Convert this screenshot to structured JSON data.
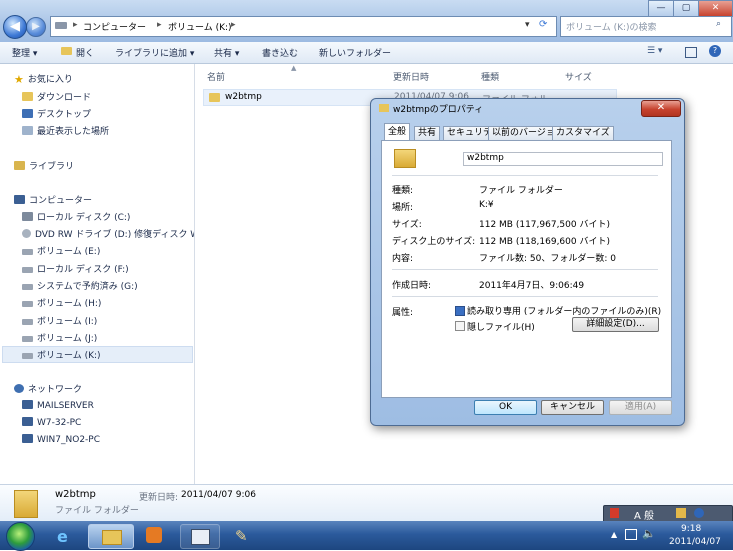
{
  "explorer": {
    "address_parts": [
      "コンピューター",
      "ボリューム (K:)"
    ],
    "search_placeholder": "ボリューム (K:)の検索",
    "commands": [
      "整理 ▾",
      "開く",
      "ライブラリに追加 ▾",
      "共有 ▾",
      "書き込む",
      "新しいフォルダー"
    ],
    "nav": {
      "favorites": "お気に入り",
      "favorites_items": [
        "ダウンロード",
        "デスクトップ",
        "最近表示した場所"
      ],
      "libraries": "ライブラリ",
      "computer": "コンピューター",
      "drives": [
        "ローカル ディスク (C:)",
        "DVD RW ドライブ (D:) 修復ディスク W",
        "ボリューム (E:)",
        "ローカル ディスク (F:)",
        "システムで予約済み (G:)",
        "ボリューム (H:)",
        "ボリューム (I:)",
        "ボリューム (J:)",
        "ボリューム (K:)"
      ],
      "network": "ネットワーク",
      "network_items": [
        "MAILSERVER",
        "W7-32-PC",
        "WIN7_NO2-PC"
      ]
    },
    "columns": [
      "名前",
      "更新日時",
      "種類",
      "サイズ"
    ],
    "file": {
      "name": "w2btmp",
      "modified": "2011/04/07 9:06",
      "type": "ファイル フォル"
    },
    "details": {
      "name": "w2btmp",
      "type": "ファイル フォルダー",
      "modified_label": "更新日時:",
      "modified": "2011/04/07 9:06"
    }
  },
  "dialog": {
    "title": "w2btmpのプロパティ",
    "tabs": [
      "全般",
      "共有",
      "セキュリティ",
      "以前のバージョン",
      "カスタマイズ"
    ],
    "name_value": "w2btmp",
    "fields": [
      {
        "label": "種類:",
        "value": "ファイル フォルダー"
      },
      {
        "label": "場所:",
        "value": "K:¥"
      },
      {
        "label": "サイズ:",
        "value": "112 MB (117,967,500 バイト)"
      },
      {
        "label": "ディスク上のサイズ:",
        "value": "112 MB (118,169,600 バイト)"
      },
      {
        "label": "内容:",
        "value": "ファイル数: 50、フォルダー数: 0"
      }
    ],
    "created_label": "作成日時:",
    "created_value": "2011年4月7日、9:06:49",
    "attributes_label": "属性:",
    "readonly_label": "読み取り専用 (フォルダー内のファイルのみ)(R)",
    "hidden_label": "隠しファイル(H)",
    "advanced_button": "詳細設定(D)...",
    "ok": "OK",
    "cancel": "キャンセル",
    "apply": "適用(A)"
  },
  "taskbar": {
    "time": "9:18",
    "date": "2011/04/07",
    "ime": "A 般"
  },
  "colors": {
    "accent": "#3f7ad6",
    "selection": "#cde0f7",
    "close": "#c7432f"
  }
}
